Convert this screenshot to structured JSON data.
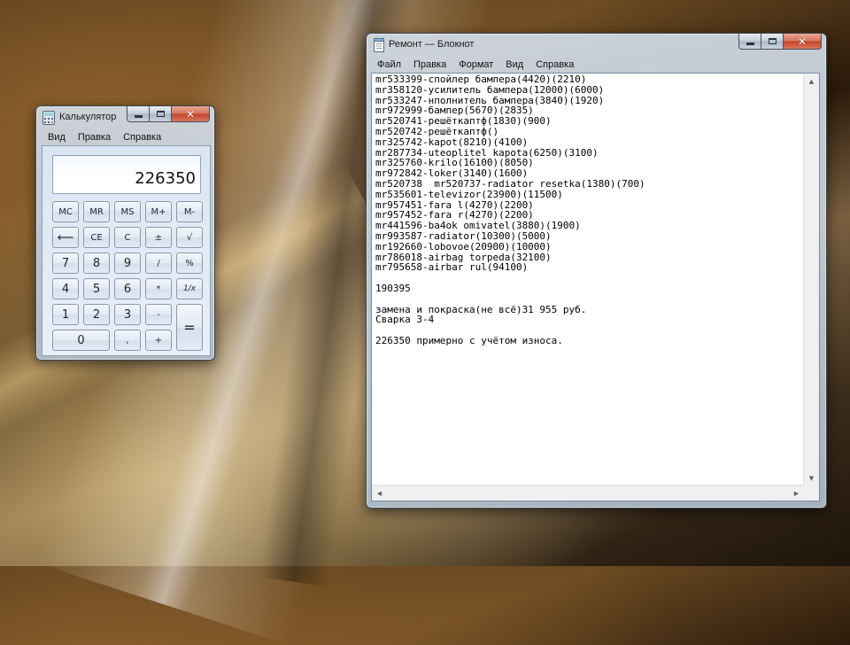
{
  "calculator": {
    "title": "Калькулятор",
    "menu": [
      "Вид",
      "Правка",
      "Справка"
    ],
    "display": "226350",
    "keys": {
      "mc": "MC",
      "mr": "MR",
      "ms": "MS",
      "mplus": "M+",
      "mminus": "M-",
      "backspace": "⟵",
      "ce": "CE",
      "c": "C",
      "plusminus": "±",
      "sqrt": "√",
      "d7": "7",
      "d8": "8",
      "d9": "9",
      "div": "/",
      "pct": "%",
      "d4": "4",
      "d5": "5",
      "d6": "6",
      "mul": "*",
      "recip": "1/x",
      "d1": "1",
      "d2": "2",
      "d3": "3",
      "sub": "-",
      "eq": "=",
      "d0": "0",
      "dot": ",",
      "add": "+"
    }
  },
  "notepad": {
    "title": "Ремонт — Блокнот",
    "menu": [
      "Файл",
      "Правка",
      "Формат",
      "Вид",
      "Справка"
    ],
    "lines": [
      "mr533399-спойлер бампера(4420)(2210)",
      "mr358120-усилитель бампера(12000)(6000)",
      "mr533247-нполнитель бампера(3840)(1920)",
      "mr972999-бампер(5670)(2835)",
      "mr520741-решёткаптф(1830)(900)",
      "mr520742-решёткаптф()",
      "mr325742-kapot(8210)(4100)",
      "mr287734-uteoplitel kapota(6250)(3100)",
      "mr325760-krilo(16100)(8050)",
      "mr972842-loker(3140)(1600)",
      "mr520738  mr520737-radiator resetka(1380)(700)",
      "mr535601-televizor(23900)(11500)",
      "mr957451-fara l(4270)(2200)",
      "mr957452-fara r(4270)(2200)",
      "mr441596-ba4ok omivatel(3880)(1900)",
      "mr993587-radiator(10300)(5000)",
      "mr192660-lobovoe(20900)(10000)",
      "mr786018-airbag torpeda(32100)",
      "mr795658-airbar rul(94100)",
      "",
      "190395",
      "",
      "замена и покраска(не всё)31 955 руб.",
      "Сварка 3-4",
      "",
      "226350 примерно с учётом износа."
    ]
  }
}
